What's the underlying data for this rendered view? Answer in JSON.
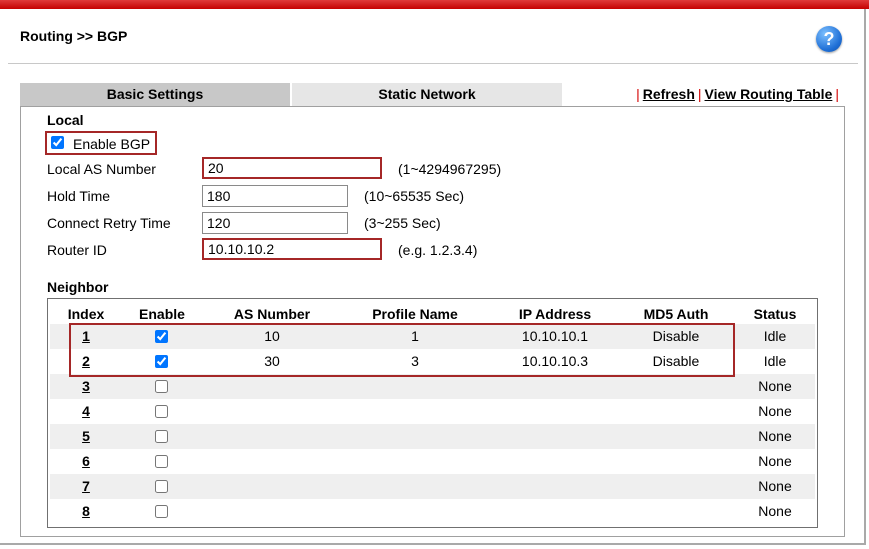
{
  "header": {
    "title": "Routing >> BGP",
    "help_symbol": "?"
  },
  "tabs": [
    {
      "label": "Basic Settings",
      "active": true
    },
    {
      "label": "Static Network",
      "active": false
    }
  ],
  "links": {
    "separator": "|",
    "refresh": "Refresh",
    "view_routing_table": "View Routing Table"
  },
  "local": {
    "title": "Local",
    "enable_label": "Enable BGP",
    "enable_checked": true,
    "fields": [
      {
        "label": "Local AS Number",
        "value": "20",
        "hint": "(1~4294967295)"
      },
      {
        "label": "Hold Time",
        "value": "180",
        "hint": "(10~65535 Sec)"
      },
      {
        "label": "Connect Retry Time",
        "value": "120",
        "hint": "(3~255 Sec)"
      },
      {
        "label": "Router ID",
        "value": "10.10.10.2",
        "hint": "(e.g. 1.2.3.4)"
      }
    ]
  },
  "neighbor": {
    "title": "Neighbor",
    "columns": [
      "Index",
      "Enable",
      "AS Number",
      "Profile Name",
      "IP Address",
      "MD5 Auth",
      "Status"
    ],
    "rows": [
      {
        "index": "1",
        "enabled": true,
        "as_number": "10",
        "profile": "1",
        "ip": "10.10.10.1",
        "md5": "Disable",
        "status": "Idle"
      },
      {
        "index": "2",
        "enabled": true,
        "as_number": "30",
        "profile": "3",
        "ip": "10.10.10.3",
        "md5": "Disable",
        "status": "Idle"
      },
      {
        "index": "3",
        "enabled": false,
        "as_number": "",
        "profile": "",
        "ip": "",
        "md5": "",
        "status": "None"
      },
      {
        "index": "4",
        "enabled": false,
        "as_number": "",
        "profile": "",
        "ip": "",
        "md5": "",
        "status": "None"
      },
      {
        "index": "5",
        "enabled": false,
        "as_number": "",
        "profile": "",
        "ip": "",
        "md5": "",
        "status": "None"
      },
      {
        "index": "6",
        "enabled": false,
        "as_number": "",
        "profile": "",
        "ip": "",
        "md5": "",
        "status": "None"
      },
      {
        "index": "7",
        "enabled": false,
        "as_number": "",
        "profile": "",
        "ip": "",
        "md5": "",
        "status": "None"
      },
      {
        "index": "8",
        "enabled": false,
        "as_number": "",
        "profile": "",
        "ip": "",
        "md5": "",
        "status": "None"
      }
    ]
  }
}
